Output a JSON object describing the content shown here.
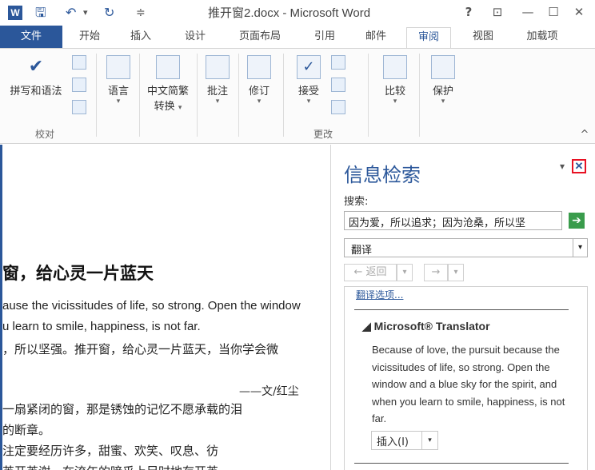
{
  "titlebar": {
    "title": "推开窗2.docx - Microsoft Word",
    "app_icon": "W",
    "qa": {
      "save": "🖫",
      "undo": "↶",
      "undo_menu": "▾",
      "redo": "↻",
      "custom": "≑"
    },
    "help": "?",
    "ribbon_opts": "⊡",
    "minimize": "—",
    "maximize": "☐",
    "close": "✕"
  },
  "tabs": [
    "文件",
    "开始",
    "插入",
    "设计",
    "页面布局",
    "引用",
    "邮件",
    "审阅",
    "视图",
    "加载项"
  ],
  "ribbon": {
    "spelling": "拼写和语法",
    "proofing_group": "校对",
    "language": "语言",
    "chinese_convert_1": "中文简繁",
    "chinese_convert_2": "转换",
    "comment": "批注",
    "revise": "修订",
    "accept": "接受",
    "changes_group": "更改",
    "compare": "比较",
    "protect": "保护",
    "dropdown_glyph": "▾",
    "collapse_glyph": "^"
  },
  "document": {
    "heading": "窗，给心灵一片蓝天",
    "en_line_1": "ause the vicissitudes of life, so strong. Open the window",
    "en_line_2": "u learn to smile, happiness, is not far.",
    "cn_line_1": "，所以坚强。推开窗，给心灵一片蓝天，当你学会微",
    "author": "——文/红尘",
    "cn_line_2": "一扇紧闭的窗，那是锈蚀的记忆不愿承载的泪",
    "cn_line_3": "的断章。",
    "cn_line_4": "注定要经历许多，甜蜜、欢笑、叹息、彷",
    "cn_line_5": "英开英谢，在流年的暗乎上足时地存开英。"
  },
  "research_pane": {
    "title": "信息检索",
    "menu_arrow": "▾",
    "close": "✕",
    "search_label": "搜索:",
    "search_value": "因为爱，所以追求；因为沧桑，所以坚",
    "go_glyph": "➔",
    "service": "翻译",
    "back": "← 返回",
    "forward": "→",
    "options_link": "翻译选项...",
    "translator_title": "◢ Microsoft® Translator",
    "translation": "Because of love, the pursuit because the vicissitudes of life, so strong. Open the window and a blue sky for the spirit, and when you learn to smile, happiness, is not far.",
    "insert": "插入(I)"
  },
  "colors": {
    "accent": "#2b579a",
    "close_highlight": "#e81123",
    "go_button": "#3a9c4c"
  }
}
